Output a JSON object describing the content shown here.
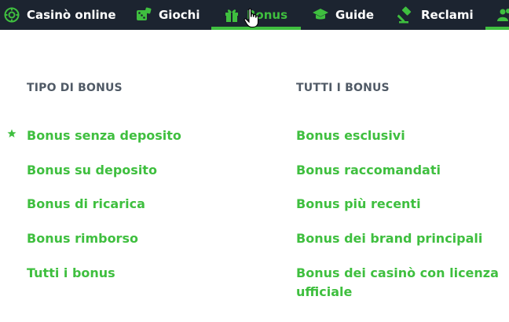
{
  "nav": {
    "items": [
      {
        "label": "Casinò online",
        "icon": "casino-chip-icon"
      },
      {
        "label": "Giochi",
        "icon": "dice-icon"
      },
      {
        "label": "Bonus",
        "icon": "gift-icon",
        "active": true
      },
      {
        "label": "Guide",
        "icon": "graduation-cap-icon"
      },
      {
        "label": "Reclami",
        "icon": "gavel-icon"
      }
    ]
  },
  "dropdown": {
    "col1": {
      "heading": "TIPO DI BONUS",
      "links": [
        "Bonus senza deposito",
        "Bonus su deposito",
        "Bonus di ricarica",
        "Bonus rimborso",
        "Tutti i bonus"
      ]
    },
    "col2": {
      "heading": "TUTTI I BONUS",
      "links": [
        "Bonus esclusivi",
        "Bonus raccomandati",
        "Bonus più recenti",
        "Bonus dei brand principali",
        "Bonus dei casinò con licenza ufficiale"
      ]
    }
  },
  "colors": {
    "navbar_bg": "#1c2430",
    "accent_green": "#3fbf3f",
    "heading_gray": "#505a66"
  }
}
